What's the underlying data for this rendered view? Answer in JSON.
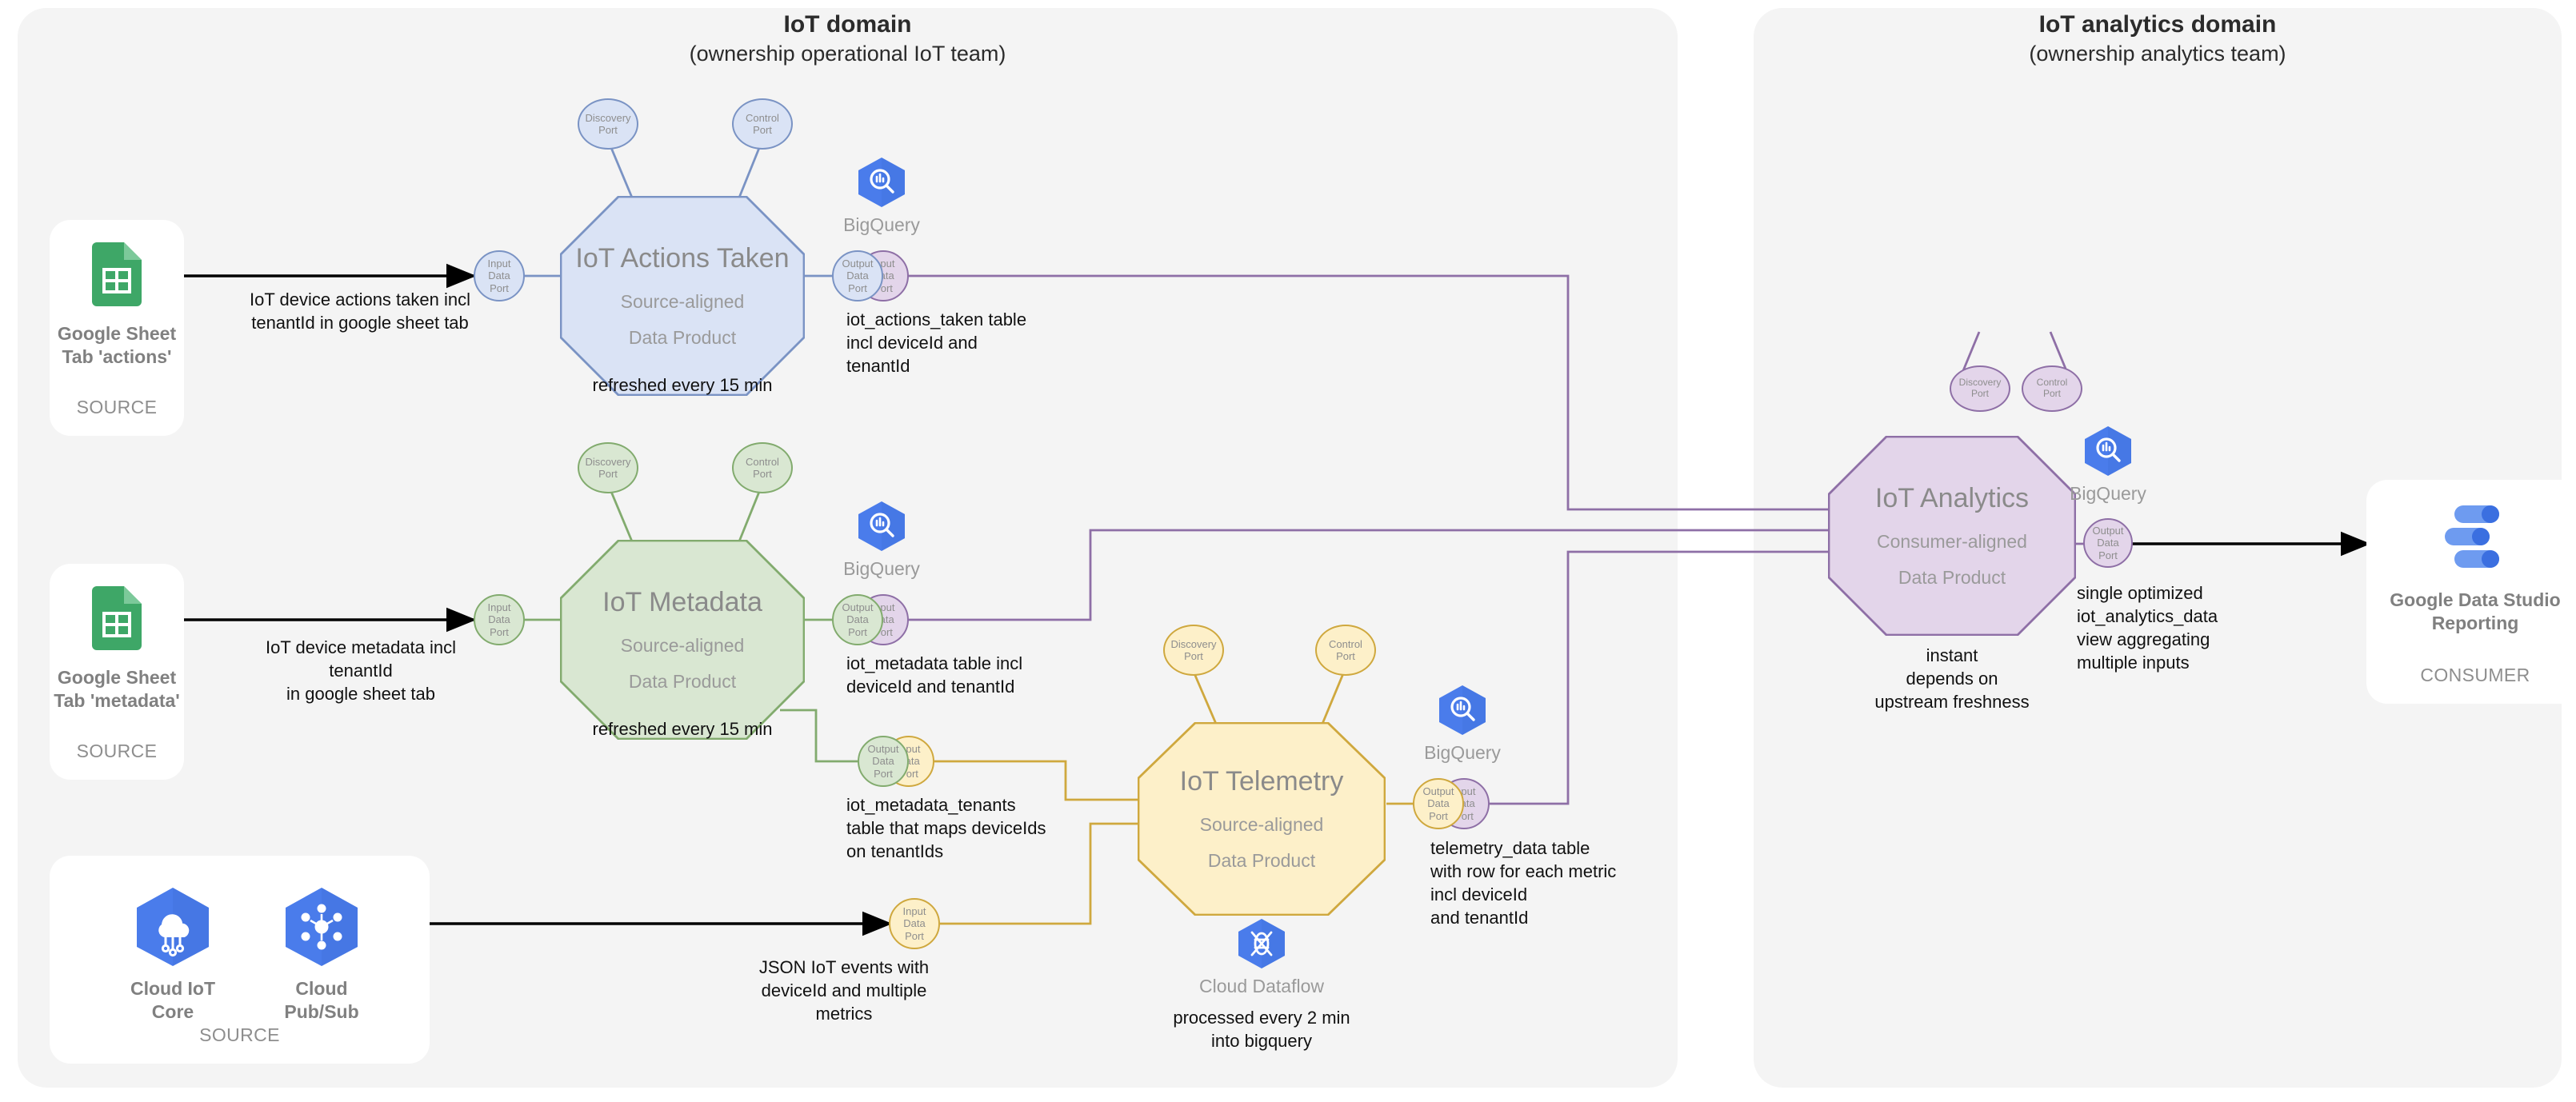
{
  "domains": [
    {
      "title": "IoT domain",
      "subtitle": "(ownership operational IoT team)"
    },
    {
      "title": "IoT analytics domain",
      "subtitle": "(ownership analytics team)"
    }
  ],
  "sources": [
    {
      "icon": "google-sheets-icon",
      "label": "Google Sheet\nTab 'actions'",
      "kind": "SOURCE"
    },
    {
      "icon": "google-sheets-icon",
      "label": "Google Sheet\nTab 'metadata'",
      "kind": "SOURCE"
    },
    {
      "icon": "cloud-iot-core-icon",
      "label": "Cloud IoT\nCore",
      "icon2": "cloud-pubsub-icon",
      "label2": "Cloud\nPub/Sub",
      "kind": "SOURCE"
    }
  ],
  "consumer": {
    "icon": "google-data-studio-icon",
    "label": "Google Data Studio\nReporting",
    "kind": "CONSUMER"
  },
  "ports": {
    "input": "Input\nData\nPort",
    "output": "Output\nData\nPort",
    "discovery": "Discovery\nPort",
    "control": "Control\nPort"
  },
  "products": [
    {
      "id": "actions",
      "title": "IoT Actions Taken",
      "line1": "Source-aligned",
      "line2": "Data Product",
      "sla": "refreshed every 15 min",
      "tech": "BigQuery",
      "output_note": "iot_actions_taken table\nincl deviceId and\ntenantId",
      "fill": "#dae3f5",
      "stroke": "#7a93c4"
    },
    {
      "id": "metadata",
      "title": "IoT Metadata",
      "line1": "Source-aligned",
      "line2": "Data Product",
      "sla": "refreshed every 15 min",
      "tech": "BigQuery",
      "output_note": "iot_metadata table incl\ndeviceId and tenantId",
      "output_note2": "iot_metadata_tenants\ntable that maps deviceIds\non tenantIds",
      "fill": "#d9e7d2",
      "stroke": "#82ab6e"
    },
    {
      "id": "telemetry",
      "title": "IoT Telemetry",
      "line1": "Source-aligned",
      "line2": "Data Product",
      "sla": "processed every 2 min\ninto bigquery",
      "tech": "BigQuery",
      "pipeline_tech": "Cloud Dataflow",
      "output_note": "telemetry_data table\nwith row for each metric\nincl deviceId\nand tenantId",
      "fill": "#fdf0c9",
      "stroke": "#cfa83e"
    },
    {
      "id": "analytics",
      "title": "IoT Analytics",
      "line1": "Consumer-aligned",
      "line2": "Data Product",
      "sla": "instant\ndepends on\nupstream freshness",
      "tech": "BigQuery",
      "output_note": "single optimized\niot_analytics_data\nview aggregating\nmultiple inputs",
      "fill": "#e3d5ea",
      "stroke": "#8e6fa6"
    }
  ],
  "flow_notes": [
    "IoT device actions taken incl\ntenantId in google sheet tab",
    "IoT device metadata incl tenantId\nin google sheet tab",
    "JSON IoT events with\ndeviceId and multiple\nmetrics"
  ],
  "colors": {
    "blue_fill": "#dae3f5",
    "blue_stroke": "#7a93c4",
    "green_fill": "#d9e7d2",
    "green_stroke": "#82ab6e",
    "yellow_fill": "#fdf0c9",
    "yellow_stroke": "#cfa83e",
    "purple_fill": "#e3d5ea",
    "purple_stroke": "#8e6fa6",
    "gcp_blue": "#4a7ceb",
    "sheets_green": "#3ea767",
    "panel_bg": "#f4f4f4",
    "text_dark": "#111111",
    "text_muted": "#8e8e8e"
  }
}
